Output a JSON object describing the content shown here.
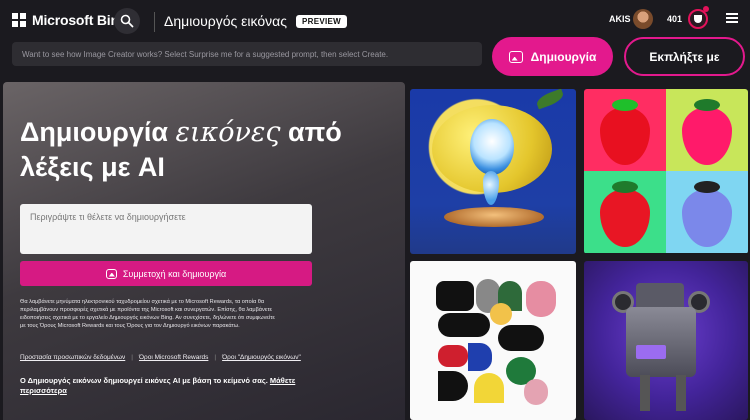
{
  "header": {
    "brand": "Microsoft Bing",
    "title": "Δημιουργός εικόνας",
    "preview_badge": "PREVIEW",
    "user_name": "AKIS",
    "points": "401"
  },
  "prompt_bar": {
    "placeholder": "Want to see how Image Creator works? Select Surprise me for a suggested prompt, then select Create.",
    "create_label": "Δημιουργία",
    "surprise_label": "Εκπλήξτε με"
  },
  "hero": {
    "headline_before": "Δημιουργία ",
    "headline_italic": "εικόνες",
    "headline_after": " από λέξεις με AI",
    "input_placeholder": "Περιγράψτε τι θέλετε να δημιουργήσετε",
    "join_label": "Συμμετοχή και δημιουργία",
    "fine_print": "Θα λαμβάνετε μηνύματα ηλεκτρονικού ταχυδρομείου σχετικά με το Microsoft Rewards, τα οποία θα περιλαμβάνουν προσφορές σχετικά με προϊόντα της Microsoft και συνεργατών. Επίσης, θα λαμβάνετε ειδοποιήσεις σχετικά με το εργαλείο Δημιουργός εικόνων Bing. Αν συνεχίσετε, δηλώνετε ότι συμφωνείτε με τους Όρους Microsoft Rewards και τους Όρους για τον Δημιουργό εικόνων παρακάτω.",
    "links": [
      "Προστασία προσωπικών δεδομένων",
      "Όροι Microsoft Rewards",
      "Όροι \"Δημιουργός εικόνων\""
    ],
    "footer_text": "Ο Δημιουργός εικόνων δημιουργεί εικόνες AI με βάση το κείμενό σας. ",
    "footer_link": "Μάθετε περισσότερα"
  },
  "colors": {
    "accent": "#e3198d",
    "background": "#1b1a1f"
  },
  "icons": [
    "search-icon",
    "microsoft-logo-icon",
    "image-create-icon",
    "rewards-icon",
    "menu-icon"
  ]
}
